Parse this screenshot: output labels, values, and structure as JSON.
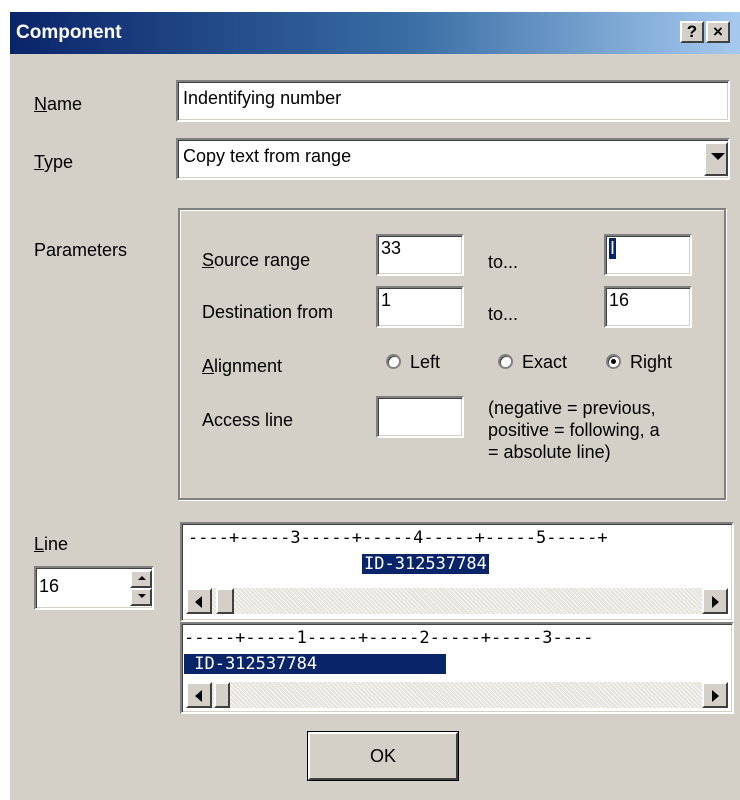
{
  "window": {
    "title": "Component",
    "help_label": "?",
    "close_label": "×"
  },
  "name": {
    "label_key": "N",
    "label_rest": "ame",
    "value": "Indentifying number"
  },
  "type": {
    "label_key": "T",
    "label_rest": "ype",
    "value": "Copy text from range"
  },
  "parameters": {
    "label": "Parameters",
    "source": {
      "label_key": "S",
      "label_rest": "ource range",
      "from": "33",
      "to_label": "to...",
      "to": "I"
    },
    "destination": {
      "label": "Destination from",
      "from": "1",
      "to_label": "to...",
      "to": "16"
    },
    "alignment": {
      "label_key": "A",
      "label_rest": "lignment",
      "options": [
        "Left",
        "Exact",
        "Right"
      ],
      "selected": "Right"
    },
    "access_line": {
      "label": "Access line",
      "value": "",
      "note": [
        "(negative = previous,",
        "positive = following, a",
        "= absolute line)"
      ]
    }
  },
  "line": {
    "label_key": "L",
    "label_rest": "ine",
    "value": "16"
  },
  "preview_top": {
    "ruler": "----+-----3-----+-----4-----+-----5-----+",
    "selection": "ID-312537784"
  },
  "preview_bottom": {
    "ruler": "-----+-----1-----+-----2-----+-----3----",
    "selection": " ID-312537784"
  },
  "ok_button": "OK"
}
